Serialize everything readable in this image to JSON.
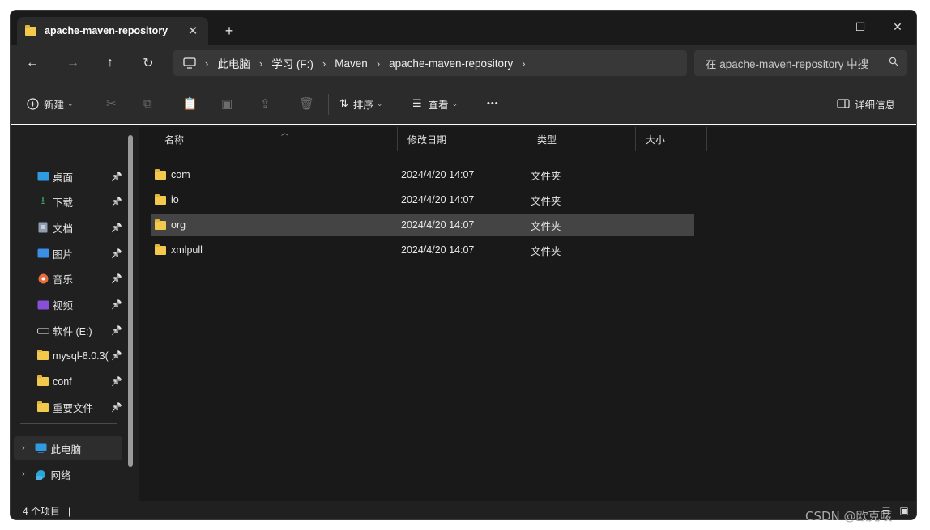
{
  "tab": {
    "title": "apache-maven-repository",
    "close": "✕",
    "new_tab": "+"
  },
  "window_controls": {
    "minimize": "—",
    "maximize": "☐",
    "close": "✕"
  },
  "nav": {
    "back": "←",
    "forward": "→",
    "up": "↑",
    "refresh": "↻"
  },
  "breadcrumb": [
    "此电脑",
    "学习 (F:)",
    "Maven",
    "apache-maven-repository"
  ],
  "search": {
    "placeholder": "在 apache-maven-repository 中搜"
  },
  "toolbar": {
    "new_label": "新建",
    "sort_label": "排序",
    "view_label": "查看",
    "more": "•••",
    "details_label": "详细信息"
  },
  "sidebar": {
    "quick_access": [
      {
        "label": "桌面",
        "icon": "desktop-icon",
        "color": "#2f9be4"
      },
      {
        "label": "下载",
        "icon": "download-icon",
        "color": "#3aa86b"
      },
      {
        "label": "文档",
        "icon": "document-icon",
        "color": "#8f9db0"
      },
      {
        "label": "图片",
        "icon": "pictures-icon",
        "color": "#3a8ee6"
      },
      {
        "label": "音乐",
        "icon": "music-icon",
        "color": "#e86d3d"
      },
      {
        "label": "视频",
        "icon": "video-icon",
        "color": "#8a4fd8"
      },
      {
        "label": "软件 (E:)",
        "icon": "drive-icon",
        "color": "#c9c9c9"
      },
      {
        "label": "mysql-8.0.3(",
        "icon": "folder-icon",
        "color": "#f2c94c"
      },
      {
        "label": "conf",
        "icon": "folder-icon",
        "color": "#f2c94c"
      },
      {
        "label": "重要文件",
        "icon": "folder-icon",
        "color": "#f2c94c"
      }
    ],
    "tree": [
      {
        "label": "此电脑",
        "icon": "computer-icon"
      },
      {
        "label": "网络",
        "icon": "network-icon"
      }
    ]
  },
  "columns": {
    "name": "名称",
    "date": "修改日期",
    "type": "类型",
    "size": "大小"
  },
  "files": [
    {
      "name": "com",
      "date": "2024/4/20 14:07",
      "type": "文件夹"
    },
    {
      "name": "io",
      "date": "2024/4/20 14:07",
      "type": "文件夹"
    },
    {
      "name": "org",
      "date": "2024/4/20 14:07",
      "type": "文件夹"
    },
    {
      "name": "xmlpull",
      "date": "2024/4/20 14:07",
      "type": "文件夹"
    }
  ],
  "status": {
    "item_count": "4 个项目",
    "cursor": "|"
  },
  "watermark": "CSDN @欧克唛"
}
